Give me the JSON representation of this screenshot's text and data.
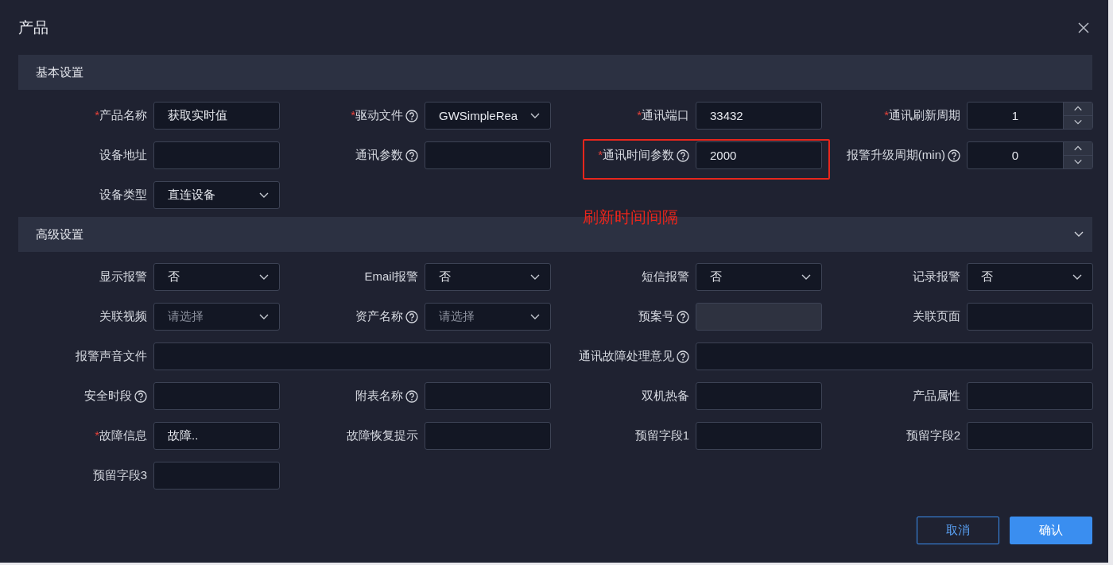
{
  "dialog": {
    "title": "产品"
  },
  "sections": [
    {
      "title": "基本设置",
      "fields": [
        {
          "label": "产品名称",
          "required_mark": "*",
          "help": false,
          "kind": "text",
          "value": "获取实时值",
          "highlighted": false
        },
        {
          "label": "驱动文件",
          "required_mark": "*",
          "help": true,
          "kind": "select",
          "value": "GWSimpleRea",
          "highlighted": false
        },
        {
          "label": "通讯端口",
          "required_mark": "*",
          "help": false,
          "kind": "text",
          "value": "33432",
          "highlighted": false
        },
        {
          "label": "通讯刷新周期",
          "required_mark": "*",
          "help": false,
          "kind": "number",
          "value": "1",
          "highlighted": false
        },
        {
          "label": "设备地址",
          "help": false,
          "kind": "text",
          "highlighted": false
        },
        {
          "label": "通讯参数",
          "help": true,
          "kind": "text",
          "highlighted": false
        },
        {
          "label": "通讯时间参数",
          "required_mark": "*",
          "help": true,
          "kind": "text",
          "value": "2000",
          "highlighted": true,
          "annotation": "刷新时间间隔"
        },
        {
          "label": "报警升级周期(min)",
          "help": true,
          "kind": "number",
          "value": "0",
          "highlighted": false
        },
        {
          "label": "设备类型",
          "help": false,
          "kind": "select",
          "value": "直连设备",
          "highlighted": false
        }
      ]
    },
    {
      "title": "高级设置",
      "expanded": true,
      "fields": [
        {
          "label": "显示报警",
          "help": false,
          "kind": "select",
          "value": "否",
          "highlighted": false
        },
        {
          "label": "Email报警",
          "help": false,
          "kind": "select",
          "value": "否",
          "highlighted": false
        },
        {
          "label": "短信报警",
          "help": false,
          "kind": "select",
          "value": "否",
          "highlighted": false
        },
        {
          "label": "记录报警",
          "help": false,
          "kind": "select",
          "value": "否",
          "highlighted": false
        },
        {
          "label": "关联视频",
          "help": false,
          "kind": "select",
          "placeholder": "请选择",
          "highlighted": false
        },
        {
          "label": "资产名称",
          "help": true,
          "kind": "select",
          "placeholder": "请选择",
          "highlighted": false
        },
        {
          "label": "预案号",
          "help": true,
          "kind": "disabled",
          "highlighted": false
        },
        {
          "label": "关联页面",
          "help": false,
          "kind": "text",
          "highlighted": false
        },
        {
          "label": "报警声音文件",
          "help": false,
          "kind": "wide",
          "highlighted": false
        },
        {
          "label": "通讯故障处理意见",
          "help": true,
          "kind": "wide",
          "highlighted": false
        },
        {
          "label": "安全时段",
          "help": true,
          "kind": "text",
          "highlighted": false
        },
        {
          "label": "附表名称",
          "help": true,
          "kind": "text",
          "highlighted": false
        },
        {
          "label": "双机热备",
          "help": false,
          "kind": "text",
          "highlighted": false
        },
        {
          "label": "产品属性",
          "help": false,
          "kind": "text",
          "highlighted": false
        },
        {
          "label": "故障信息",
          "required_mark": "*",
          "help": false,
          "kind": "text",
          "value": "故障..",
          "highlighted": false
        },
        {
          "label": "故障恢复提示",
          "help": false,
          "kind": "text",
          "highlighted": false
        },
        {
          "label": "预留字段1",
          "help": false,
          "kind": "text",
          "highlighted": false
        },
        {
          "label": "预留字段2",
          "help": false,
          "kind": "text",
          "highlighted": false
        },
        {
          "label": "预留字段3",
          "help": false,
          "kind": "text",
          "highlighted": false
        }
      ]
    }
  ],
  "buttons": [
    {
      "label": "取消",
      "kind": "secondary"
    },
    {
      "label": "确认",
      "kind": "primary"
    }
  ]
}
